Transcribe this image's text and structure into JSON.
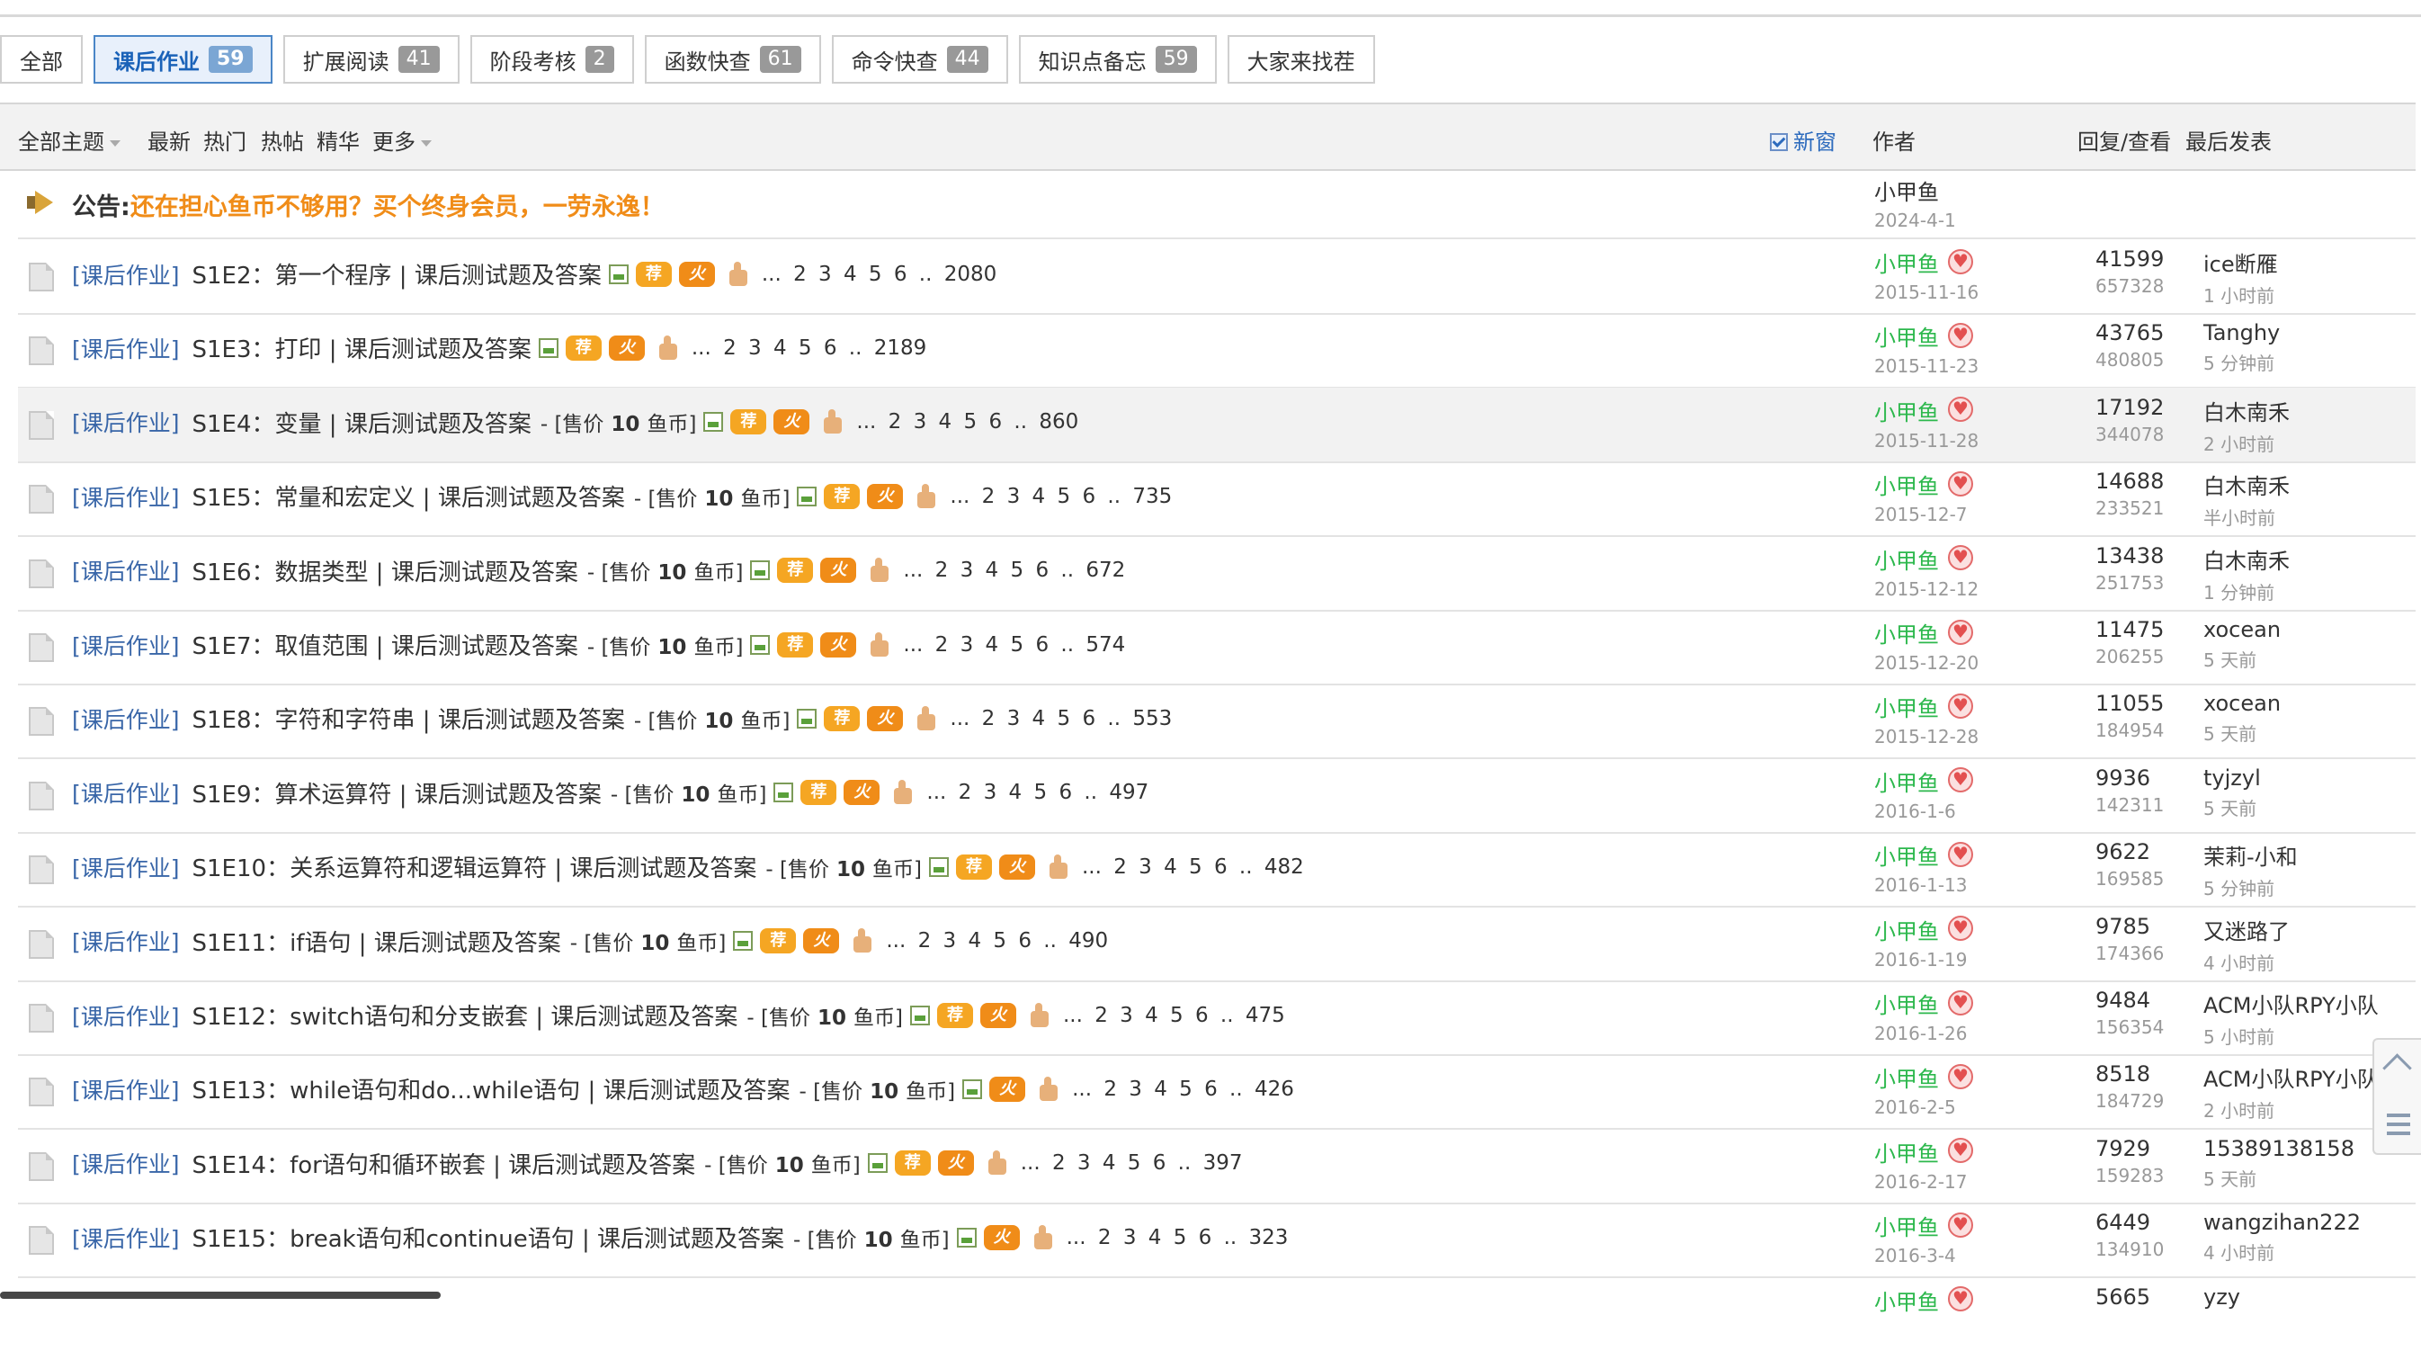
{
  "tabs": [
    {
      "label": "全部",
      "count": ""
    },
    {
      "label": "课后作业",
      "count": "59",
      "active": true
    },
    {
      "label": "扩展阅读",
      "count": "41"
    },
    {
      "label": "阶段考核",
      "count": "2"
    },
    {
      "label": "函数快查",
      "count": "61"
    },
    {
      "label": "命令快查",
      "count": "44"
    },
    {
      "label": "知识点备忘",
      "count": "59"
    },
    {
      "label": "大家来找茬",
      "count": ""
    }
  ],
  "header": {
    "all_topics": "全部主题",
    "latest": "最新",
    "hot": "热门",
    "hot_posts": "热帖",
    "digest": "精华",
    "more": "更多",
    "new_window": "新窗",
    "author": "作者",
    "reply_view": "回复/查看",
    "last_post": "最后发表"
  },
  "announcement": {
    "label": "公告:",
    "text": "还在担心鱼币不够用？买个终身会员，一劳永逸！",
    "author": "小甲鱼",
    "date": "2024-4-1"
  },
  "threads": [
    {
      "cat": "[课后作业]",
      "title": "S1E2：第一个程序 | 课后测试题及答案",
      "price": "",
      "rec": true,
      "hot": true,
      "pages": "... 2 3 4 5 6 .. 2080",
      "author": "小甲鱼",
      "date": "2015-11-16",
      "replies": "41599",
      "views": "657328",
      "last": "ice断雁",
      "last_time": "1 小时前"
    },
    {
      "cat": "[课后作业]",
      "title": "S1E3：打印 | 课后测试题及答案",
      "price": "",
      "rec": true,
      "hot": true,
      "pages": "... 2 3 4 5 6 .. 2189",
      "author": "小甲鱼",
      "date": "2015-11-23",
      "replies": "43765",
      "views": "480805",
      "last": "Tanghy",
      "last_time": "5 分钟前"
    },
    {
      "cat": "[课后作业]",
      "title": "S1E4：变量 | 课后测试题及答案",
      "price": "10",
      "rec": true,
      "hot": true,
      "pages": "... 2 3 4 5 6 .. 860",
      "author": "小甲鱼",
      "date": "2015-11-28",
      "replies": "17192",
      "views": "344078",
      "last": "白木南禾",
      "last_time": "2 小时前",
      "hl": true
    },
    {
      "cat": "[课后作业]",
      "title": "S1E5：常量和宏定义 | 课后测试题及答案",
      "price": "10",
      "rec": true,
      "hot": true,
      "pages": "... 2 3 4 5 6 .. 735",
      "author": "小甲鱼",
      "date": "2015-12-7",
      "replies": "14688",
      "views": "233521",
      "last": "白木南禾",
      "last_time": "半小时前"
    },
    {
      "cat": "[课后作业]",
      "title": "S1E6：数据类型 | 课后测试题及答案",
      "price": "10",
      "rec": true,
      "hot": true,
      "pages": "... 2 3 4 5 6 .. 672",
      "author": "小甲鱼",
      "date": "2015-12-12",
      "replies": "13438",
      "views": "251753",
      "last": "白木南禾",
      "last_time": "1 分钟前"
    },
    {
      "cat": "[课后作业]",
      "title": "S1E7：取值范围 | 课后测试题及答案",
      "price": "10",
      "rec": true,
      "hot": true,
      "pages": "... 2 3 4 5 6 .. 574",
      "author": "小甲鱼",
      "date": "2015-12-20",
      "replies": "11475",
      "views": "206255",
      "last": "xocean",
      "last_time": "5 天前"
    },
    {
      "cat": "[课后作业]",
      "title": "S1E8：字符和字符串 | 课后测试题及答案",
      "price": "10",
      "rec": true,
      "hot": true,
      "pages": "... 2 3 4 5 6 .. 553",
      "author": "小甲鱼",
      "date": "2015-12-28",
      "replies": "11055",
      "views": "184954",
      "last": "xocean",
      "last_time": "5 天前"
    },
    {
      "cat": "[课后作业]",
      "title": "S1E9：算术运算符 | 课后测试题及答案",
      "price": "10",
      "rec": true,
      "hot": true,
      "pages": "... 2 3 4 5 6 .. 497",
      "author": "小甲鱼",
      "date": "2016-1-6",
      "replies": "9936",
      "views": "142311",
      "last": "tyjzyl",
      "last_time": "5 天前"
    },
    {
      "cat": "[课后作业]",
      "title": "S1E10：关系运算符和逻辑运算符 | 课后测试题及答案",
      "price": "10",
      "rec": true,
      "hot": true,
      "pages": "... 2 3 4 5 6 .. 482",
      "author": "小甲鱼",
      "date": "2016-1-13",
      "replies": "9622",
      "views": "169585",
      "last": "茉莉-小和",
      "last_time": "5 分钟前"
    },
    {
      "cat": "[课后作业]",
      "title": "S1E11：if语句 | 课后测试题及答案",
      "price": "10",
      "rec": true,
      "hot": true,
      "pages": "... 2 3 4 5 6 .. 490",
      "author": "小甲鱼",
      "date": "2016-1-19",
      "replies": "9785",
      "views": "174366",
      "last": "又迷路了",
      "last_time": "4 小时前"
    },
    {
      "cat": "[课后作业]",
      "title": "S1E12：switch语句和分支嵌套 | 课后测试题及答案",
      "price": "10",
      "rec": true,
      "hot": true,
      "pages": "... 2 3 4 5 6 .. 475",
      "author": "小甲鱼",
      "date": "2016-1-26",
      "replies": "9484",
      "views": "156354",
      "last": "ACM小队RPY小队",
      "last_time": "5 小时前"
    },
    {
      "cat": "[课后作业]",
      "title": "S1E13：while语句和do...while语句 | 课后测试题及答案",
      "price": "10",
      "rec": false,
      "hot": true,
      "pages": "... 2 3 4 5 6 .. 426",
      "author": "小甲鱼",
      "date": "2016-2-5",
      "replies": "8518",
      "views": "184729",
      "last": "ACM小队RPY小队",
      "last_time": "2 小时前"
    },
    {
      "cat": "[课后作业]",
      "title": "S1E14：for语句和循环嵌套 | 课后测试题及答案",
      "price": "10",
      "rec": true,
      "hot": true,
      "pages": "... 2 3 4 5 6 .. 397",
      "author": "小甲鱼",
      "date": "2016-2-17",
      "replies": "7929",
      "views": "159283",
      "last": "15389138158",
      "last_time": "5 天前"
    },
    {
      "cat": "[课后作业]",
      "title": "S1E15：break语句和continue语句 | 课后测试题及答案",
      "price": "10",
      "rec": false,
      "hot": true,
      "pages": "... 2 3 4 5 6 .. 323",
      "author": "小甲鱼",
      "date": "2016-3-4",
      "replies": "6449",
      "views": "134910",
      "last": "wangzihan222",
      "last_time": "4 小时前"
    },
    {
      "cat": "",
      "title": "",
      "price": "",
      "rec": false,
      "hot": false,
      "pages": "",
      "author": "小甲鱼",
      "date": "",
      "replies": "5665",
      "views": "",
      "last": "yzy",
      "last_time": ""
    }
  ],
  "labels": {
    "price_prefix": "- [售价",
    "price_suffix": "鱼币]",
    "rec_badge": "荐",
    "hot_badge": "火"
  }
}
